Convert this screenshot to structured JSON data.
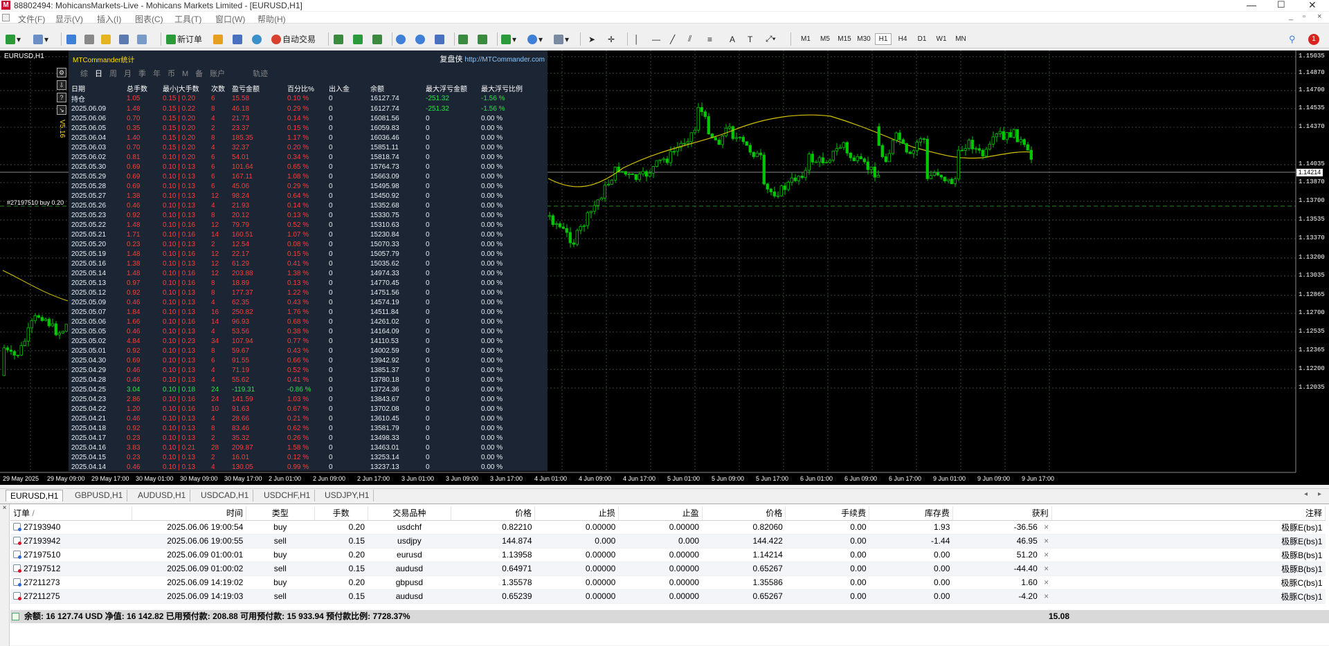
{
  "window": {
    "title": "88802494: MohicansMarkets-Live - Mohicans Markets Limited - [EURUSD,H1]",
    "logo": "M"
  },
  "menu": [
    "文件(F)",
    "显示(V)",
    "插入(I)",
    "图表(C)",
    "工具(T)",
    "窗口(W)",
    "帮助(H)"
  ],
  "toolbar": {
    "new_order": "新订单",
    "auto_trade": "自动交易",
    "timeframes": [
      "M1",
      "M5",
      "M15",
      "M30",
      "H1",
      "H4",
      "D1",
      "W1",
      "MN"
    ],
    "active_tf": "H1",
    "alert_count": "1"
  },
  "chart": {
    "symbol_label": "EURUSD,H1",
    "current_price": "1.14214",
    "order_label": "#27197510 buy 0.20",
    "y_ticks": [
      "1.15035",
      "1.14870",
      "1.14700",
      "1.14535",
      "1.14370",
      "1.14035",
      "1.13870",
      "1.13700",
      "1.13535",
      "1.13370",
      "1.13200",
      "1.13035",
      "1.12865",
      "1.12700",
      "1.12535",
      "1.12365",
      "1.12200",
      "1.12035"
    ],
    "x_ticks": [
      "29 May 2025",
      "29 May 09:00",
      "29 May 17:00",
      "30 May 01:00",
      "30 May 09:00",
      "30 May 17:00",
      "2 Jun 01:00",
      "2 Jun 09:00",
      "2 Jun 17:00",
      "3 Jun 01:00",
      "3 Jun 09:00",
      "3 Jun 17:00",
      "4 Jun 01:00",
      "4 Jun 09:00",
      "4 Jun 17:00",
      "5 Jun 01:00",
      "5 Jun 09:00",
      "5 Jun 17:00",
      "6 Jun 01:00",
      "6 Jun 09:00",
      "6 Jun 17:00",
      "9 Jun 01:00",
      "9 Jun 09:00",
      "9 Jun 17:00"
    ]
  },
  "stats": {
    "title": "MTCommander统计",
    "brand": "复盘侠",
    "brand_url": "http://MTCommander.com",
    "version": "V5.16",
    "tabs": [
      "综",
      "日",
      "周",
      "月",
      "季",
      "年",
      "币",
      "M",
      "备",
      "账户",
      "轨迹"
    ],
    "active_tab": "日",
    "columns": [
      "日期",
      "总手数",
      "最小|大手数",
      "次数",
      "盈亏金额",
      "百分比%",
      "出入金",
      "余额",
      "最大浮亏金额",
      "最大浮亏比例"
    ],
    "rows": [
      [
        "持仓",
        "1.05",
        "0.15 | 0.20",
        "6",
        "15.58",
        "0.10 %",
        "0",
        "16127.74",
        "-251.32",
        "-1.56 %"
      ],
      [
        "2025.06.09",
        "1.48",
        "0.15 | 0.22",
        "8",
        "46.18",
        "0.29 %",
        "0",
        "16127.74",
        "-251.32",
        "-1.56 %"
      ],
      [
        "2025.06.06",
        "0.70",
        "0.15 | 0.20",
        "4",
        "21.73",
        "0.14 %",
        "0",
        "16081.56",
        "0",
        "0.00 %"
      ],
      [
        "2025.06.05",
        "0.35",
        "0.15 | 0.20",
        "2",
        "23.37",
        "0.15 %",
        "0",
        "16059.83",
        "0",
        "0.00 %"
      ],
      [
        "2025.06.04",
        "1.40",
        "0.15 | 0.20",
        "8",
        "185.35",
        "1.17 %",
        "0",
        "16036.46",
        "0",
        "0.00 %"
      ],
      [
        "2025.06.03",
        "0.70",
        "0.15 | 0.20",
        "4",
        "32.37",
        "0.20 %",
        "0",
        "15851.11",
        "0",
        "0.00 %"
      ],
      [
        "2025.06.02",
        "0.81",
        "0.10 | 0.20",
        "6",
        "54.01",
        "0.34 %",
        "0",
        "15818.74",
        "0",
        "0.00 %"
      ],
      [
        "2025.05.30",
        "0.69",
        "0.10 | 0.13",
        "6",
        "101.64",
        "0.65 %",
        "0",
        "15764.73",
        "0",
        "0.00 %"
      ],
      [
        "2025.05.29",
        "0.69",
        "0.10 | 0.13",
        "6",
        "167.11",
        "1.08 %",
        "0",
        "15663.09",
        "0",
        "0.00 %"
      ],
      [
        "2025.05.28",
        "0.69",
        "0.10 | 0.13",
        "6",
        "45.06",
        "0.29 %",
        "0",
        "15495.98",
        "0",
        "0.00 %"
      ],
      [
        "2025.05.27",
        "1.38",
        "0.10 | 0.13",
        "12",
        "98.24",
        "0.64 %",
        "0",
        "15450.92",
        "0",
        "0.00 %"
      ],
      [
        "2025.05.26",
        "0.46",
        "0.10 | 0.13",
        "4",
        "21.93",
        "0.14 %",
        "0",
        "15352.68",
        "0",
        "0.00 %"
      ],
      [
        "2025.05.23",
        "0.92",
        "0.10 | 0.13",
        "8",
        "20.12",
        "0.13 %",
        "0",
        "15330.75",
        "0",
        "0.00 %"
      ],
      [
        "2025.05.22",
        "1.48",
        "0.10 | 0.16",
        "12",
        "79.79",
        "0.52 %",
        "0",
        "15310.63",
        "0",
        "0.00 %"
      ],
      [
        "2025.05.21",
        "1.71",
        "0.10 | 0.16",
        "14",
        "160.51",
        "1.07 %",
        "0",
        "15230.84",
        "0",
        "0.00 %"
      ],
      [
        "2025.05.20",
        "0.23",
        "0.10 | 0.13",
        "2",
        "12.54",
        "0.08 %",
        "0",
        "15070.33",
        "0",
        "0.00 %"
      ],
      [
        "2025.05.19",
        "1.48",
        "0.10 | 0.16",
        "12",
        "22.17",
        "0.15 %",
        "0",
        "15057.79",
        "0",
        "0.00 %"
      ],
      [
        "2025.05.16",
        "1.38",
        "0.10 | 0.13",
        "12",
        "61.29",
        "0.41 %",
        "0",
        "15035.62",
        "0",
        "0.00 %"
      ],
      [
        "2025.05.14",
        "1.48",
        "0.10 | 0.16",
        "12",
        "203.88",
        "1.38 %",
        "0",
        "14974.33",
        "0",
        "0.00 %"
      ],
      [
        "2025.05.13",
        "0.97",
        "0.10 | 0.16",
        "8",
        "18.89",
        "0.13 %",
        "0",
        "14770.45",
        "0",
        "0.00 %"
      ],
      [
        "2025.05.12",
        "0.92",
        "0.10 | 0.13",
        "8",
        "177.37",
        "1.22 %",
        "0",
        "14751.56",
        "0",
        "0.00 %"
      ],
      [
        "2025.05.09",
        "0.46",
        "0.10 | 0.13",
        "4",
        "62.35",
        "0.43 %",
        "0",
        "14574.19",
        "0",
        "0.00 %"
      ],
      [
        "2025.05.07",
        "1.84",
        "0.10 | 0.13",
        "16",
        "250.82",
        "1.76 %",
        "0",
        "14511.84",
        "0",
        "0.00 %"
      ],
      [
        "2025.05.06",
        "1.66",
        "0.10 | 0.16",
        "14",
        "96.93",
        "0.68 %",
        "0",
        "14261.02",
        "0",
        "0.00 %"
      ],
      [
        "2025.05.05",
        "0.46",
        "0.10 | 0.13",
        "4",
        "53.56",
        "0.38 %",
        "0",
        "14164.09",
        "0",
        "0.00 %"
      ],
      [
        "2025.05.02",
        "4.84",
        "0.10 | 0.23",
        "34",
        "107.94",
        "0.77 %",
        "0",
        "14110.53",
        "0",
        "0.00 %"
      ],
      [
        "2025.05.01",
        "0.92",
        "0.10 | 0.13",
        "8",
        "59.67",
        "0.43 %",
        "0",
        "14002.59",
        "0",
        "0.00 %"
      ],
      [
        "2025.04.30",
        "0.69",
        "0.10 | 0.13",
        "6",
        "91.55",
        "0.66 %",
        "0",
        "13942.92",
        "0",
        "0.00 %"
      ],
      [
        "2025.04.29",
        "0.46",
        "0.10 | 0.13",
        "4",
        "71.19",
        "0.52 %",
        "0",
        "13851.37",
        "0",
        "0.00 %"
      ],
      [
        "2025.04.28",
        "0.46",
        "0.10 | 0.13",
        "4",
        "55.62",
        "0.41 %",
        "0",
        "13780.18",
        "0",
        "0.00 %"
      ],
      [
        "2025.04.25",
        "3.04",
        "0.10 | 0.18",
        "24",
        "-119.31",
        "-0.86 %",
        "0",
        "13724.36",
        "0",
        "0.00 %"
      ],
      [
        "2025.04.23",
        "2.86",
        "0.10 | 0.16",
        "24",
        "141.59",
        "1.03 %",
        "0",
        "13843.67",
        "0",
        "0.00 %"
      ],
      [
        "2025.04.22",
        "1.20",
        "0.10 | 0.16",
        "10",
        "91.63",
        "0.67 %",
        "0",
        "13702.08",
        "0",
        "0.00 %"
      ],
      [
        "2025.04.21",
        "0.46",
        "0.10 | 0.13",
        "4",
        "28.66",
        "0.21 %",
        "0",
        "13610.45",
        "0",
        "0.00 %"
      ],
      [
        "2025.04.18",
        "0.92",
        "0.10 | 0.13",
        "8",
        "83.46",
        "0.62 %",
        "0",
        "13581.79",
        "0",
        "0.00 %"
      ],
      [
        "2025.04.17",
        "0.23",
        "0.10 | 0.13",
        "2",
        "35.32",
        "0.26 %",
        "0",
        "13498.33",
        "0",
        "0.00 %"
      ],
      [
        "2025.04.16",
        "3.83",
        "0.10 | 0.21",
        "28",
        "209.87",
        "1.58 %",
        "0",
        "13463.01",
        "0",
        "0.00 %"
      ],
      [
        "2025.04.15",
        "0.23",
        "0.10 | 0.13",
        "2",
        "16.01",
        "0.12 %",
        "0",
        "13253.14",
        "0",
        "0.00 %"
      ],
      [
        "2025.04.14",
        "0.46",
        "0.10 | 0.13",
        "4",
        "130.05",
        "0.99 %",
        "0",
        "13237.13",
        "0",
        "0.00 %"
      ]
    ]
  },
  "chart_tabs": [
    "EURUSD,H1",
    "GBPUSD,H1",
    "AUDUSD,H1",
    "USDCAD,H1",
    "USDCHF,H1",
    "USDJPY,H1"
  ],
  "terminal": {
    "columns": [
      "订单",
      "时间",
      "类型",
      "手数",
      "交易品种",
      "价格",
      "止损",
      "止盈",
      "价格",
      "手续费",
      "库存费",
      "获利",
      "注释"
    ],
    "sort_mark": "/",
    "close_glyph": "×",
    "rows": [
      {
        "order": "27193940",
        "time": "2025.06.06 19:00:54",
        "type": "buy",
        "lots": "0.20",
        "symbol": "usdchf",
        "open": "0.82210",
        "sl": "0.00000",
        "tp": "0.00000",
        "price": "0.82060",
        "commission": "0.00",
        "swap": "1.93",
        "profit": "-36.56",
        "comment": "极豚E(bs)1"
      },
      {
        "order": "27193942",
        "time": "2025.06.06 19:00:55",
        "type": "sell",
        "lots": "0.15",
        "symbol": "usdjpy",
        "open": "144.874",
        "sl": "0.000",
        "tp": "0.000",
        "price": "144.422",
        "commission": "0.00",
        "swap": "-1.44",
        "profit": "46.95",
        "comment": "极豚E(bs)1"
      },
      {
        "order": "27197510",
        "time": "2025.06.09 01:00:01",
        "type": "buy",
        "lots": "0.20",
        "symbol": "eurusd",
        "open": "1.13958",
        "sl": "0.00000",
        "tp": "0.00000",
        "price": "1.14214",
        "commission": "0.00",
        "swap": "0.00",
        "profit": "51.20",
        "comment": "极豚B(bs)1"
      },
      {
        "order": "27197512",
        "time": "2025.06.09 01:00:02",
        "type": "sell",
        "lots": "0.15",
        "symbol": "audusd",
        "open": "0.64971",
        "sl": "0.00000",
        "tp": "0.00000",
        "price": "0.65267",
        "commission": "0.00",
        "swap": "0.00",
        "profit": "-44.40",
        "comment": "极豚B(bs)1"
      },
      {
        "order": "27211273",
        "time": "2025.06.09 14:19:02",
        "type": "buy",
        "lots": "0.20",
        "symbol": "gbpusd",
        "open": "1.35578",
        "sl": "0.00000",
        "tp": "0.00000",
        "price": "1.35586",
        "commission": "0.00",
        "swap": "0.00",
        "profit": "1.60",
        "comment": "极豚C(bs)1"
      },
      {
        "order": "27211275",
        "time": "2025.06.09 14:19:03",
        "type": "sell",
        "lots": "0.15",
        "symbol": "audusd",
        "open": "0.65239",
        "sl": "0.00000",
        "tp": "0.00000",
        "price": "0.65267",
        "commission": "0.00",
        "swap": "0.00",
        "profit": "-4.20",
        "comment": "极豚C(bs)1"
      }
    ],
    "summary": "余额: 16 127.74 USD  净值: 16 142.82  已用预付款: 208.88  可用预付款: 15 933.94  预付款比例: 7728.37%",
    "total_profit": "15.08"
  },
  "colors": {
    "chart_bg": "#000000",
    "candle": "#00c800",
    "ma": "#d4c400",
    "grid": "#3a4a3a",
    "panel": "#1b2533",
    "loss": "#ff3b3b",
    "gain": "#2ee04a"
  }
}
